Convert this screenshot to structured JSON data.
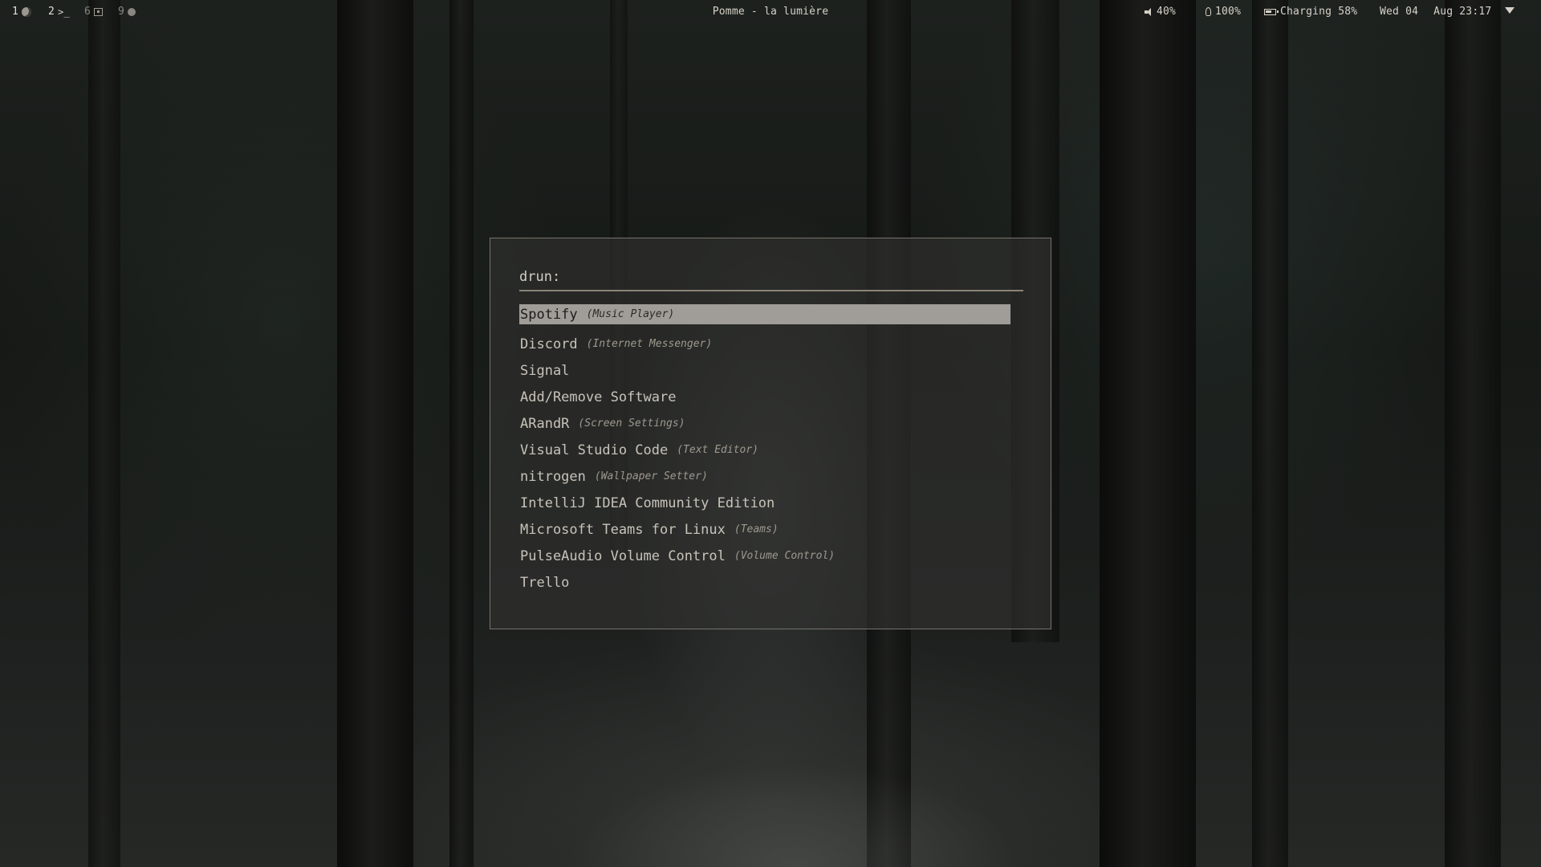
{
  "workspaces": [
    {
      "num": "1",
      "icon": "moon-icon"
    },
    {
      "num": "2",
      "icon": "terminal-prompt-icon",
      "glyph": ">_"
    },
    {
      "num": "6",
      "icon": "window-icon"
    },
    {
      "num": "9",
      "icon": "circle-icon"
    }
  ],
  "window_title": "Pomme - la lumière",
  "status": {
    "volume": "40%",
    "brightness": "100%",
    "battery": "Charging 58%",
    "date": "Wed 04",
    "month_time": "Aug 23:17"
  },
  "launcher": {
    "prompt": "drun:",
    "entries": [
      {
        "name": "Spotify",
        "generic": "(Music Player)",
        "selected": true
      },
      {
        "name": "Discord",
        "generic": "(Internet Messenger)"
      },
      {
        "name": "Signal",
        "generic": ""
      },
      {
        "name": "Add/Remove Software",
        "generic": ""
      },
      {
        "name": "ARandR",
        "generic": "(Screen Settings)"
      },
      {
        "name": "Visual Studio Code",
        "generic": "(Text Editor)"
      },
      {
        "name": "nitrogen",
        "generic": "(Wallpaper Setter)"
      },
      {
        "name": "IntelliJ IDEA Community Edition",
        "generic": ""
      },
      {
        "name": "Microsoft Teams for Linux",
        "generic": "(Teams)"
      },
      {
        "name": "PulseAudio Volume Control",
        "generic": "(Volume Control)"
      },
      {
        "name": "Trello",
        "generic": ""
      }
    ]
  },
  "colors": {
    "selection_bg": "#a09d98",
    "launcher_border": "#77726b",
    "prompt_underline": "#8b8378"
  }
}
